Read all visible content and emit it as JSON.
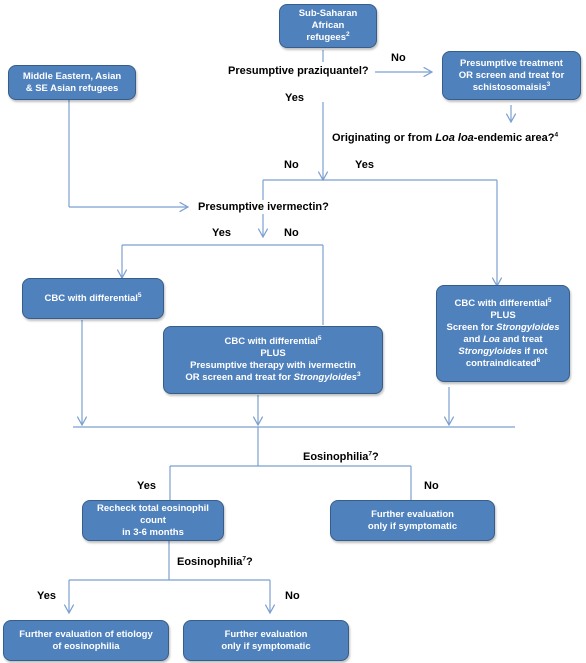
{
  "colors": {
    "box_fill": "#4f81bd",
    "box_border": "#385d8a",
    "connector": "#7ba0d0",
    "text_on_box": "#ffffff",
    "label_text": "#000000"
  },
  "boxes": {
    "sub_saharan": {
      "line1": "Sub-Saharan",
      "line2": "African",
      "line3": "refugees",
      "sup": "2"
    },
    "middle_eastern": {
      "line1": "Middle Eastern, Asian",
      "line2": "& SE Asian refugees"
    },
    "schisto": {
      "line1": "Presumptive treatment",
      "line2": "OR screen and treat for",
      "line3": "schistosomaisis",
      "sup": "3"
    },
    "cbc_left": {
      "text": "CBC with differential",
      "sup": "5"
    },
    "cbc_middle": {
      "line1": "CBC with differential",
      "sup1": "5",
      "line2": "PLUS",
      "line3": "Presumptive therapy with ivermectin",
      "line4a": "OR screen and treat for ",
      "line4b": "Strongyloides",
      "sup2": "3"
    },
    "cbc_right": {
      "line1": "CBC with differential",
      "sup1": "5",
      "line2": "PLUS",
      "line3a": "Screen for ",
      "line3b": "Strongyloides",
      "line4a": "and ",
      "line4b": "Loa",
      "line4c": " and treat",
      "line5a": "Strongyloides",
      "line5b": " if not",
      "line6": "contraindicated",
      "sup2": "6"
    },
    "recheck": {
      "line1": "Recheck total eosinophil count",
      "line2": "in 3-6 months"
    },
    "further_symptomatic_1": {
      "line1": "Further evaluation",
      "line2": "only if symptomatic"
    },
    "further_etiology": {
      "line1": "Further evaluation of etiology",
      "line2": "of eosinophilia"
    },
    "further_symptomatic_2": {
      "line1": "Further evaluation",
      "line2": "only if symptomatic"
    }
  },
  "labels": {
    "q_praziquantel": "Presumptive praziquantel?",
    "no_1": "No",
    "yes_1": "Yes",
    "q_loa_a": "Originating or from ",
    "q_loa_b": "Loa loa",
    "q_loa_c": "-endemic area?",
    "q_loa_sup": "4",
    "no_2": "No",
    "yes_2": "Yes",
    "q_ivermectin": "Presumptive ivermectin?",
    "yes_3": "Yes",
    "no_3": "No",
    "q_eosinophilia_1": "Eosinophilia",
    "q_eosinophilia_1_sup": "7",
    "q_eosinophilia_1_end": "?",
    "yes_4": "Yes",
    "no_4": "No",
    "q_eosinophilia_2": "Eosinophilia",
    "q_eosinophilia_2_sup": "7",
    "q_eosinophilia_2_end": "?",
    "yes_5": "Yes",
    "no_5": "No"
  }
}
